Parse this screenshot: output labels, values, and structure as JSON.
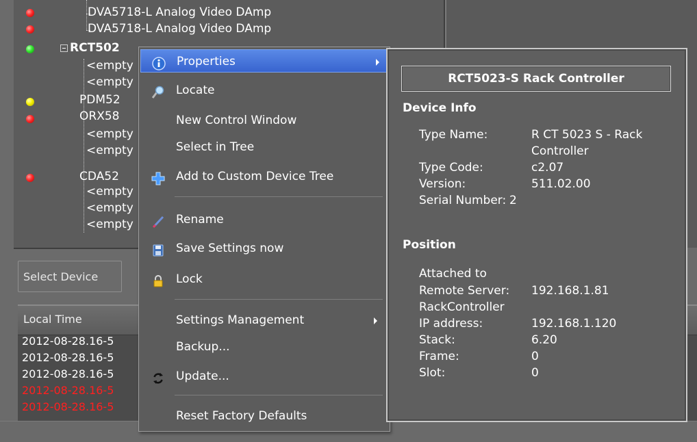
{
  "tree": {
    "items": [
      {
        "label": "DVA5718-L Analog Video DAmp",
        "status": "red"
      },
      {
        "label": "DVA5718-L Analog Video DAmp",
        "status": "red"
      },
      {
        "label": "RCT502",
        "status": "green",
        "expanded": true
      },
      {
        "label": "<empty",
        "status": "none"
      },
      {
        "label": "<empty",
        "status": "none"
      },
      {
        "label": "PDM52",
        "status": "yellow"
      },
      {
        "label": "ORX58",
        "status": "red"
      },
      {
        "label": "<empty",
        "status": "none"
      },
      {
        "label": "<empty",
        "status": "none"
      },
      {
        "label": "CDA52",
        "status": "red"
      },
      {
        "label": "<empty",
        "status": "none"
      },
      {
        "label": "<empty",
        "status": "none"
      },
      {
        "label": "<empty",
        "status": "none"
      }
    ],
    "colors": {
      "red": "#ff2a2a",
      "green": "#35e52f",
      "yellow": "#f5f000"
    }
  },
  "select_device_label": "Select Device",
  "log": {
    "column_header": "Local Time",
    "rows": [
      {
        "text": "2012-08-28.16-5",
        "color": "#ffffff"
      },
      {
        "text": "2012-08-28.16-5",
        "color": "#ffffff"
      },
      {
        "text": "2012-08-28.16-5",
        "color": "#ffffff"
      },
      {
        "text": "2012-08-28.16-5",
        "color": "#ff2020"
      },
      {
        "text": "2012-08-28.16-5",
        "color": "#ff2020"
      }
    ]
  },
  "context_menu": {
    "items": [
      {
        "label": "Properties",
        "icon": "info-icon",
        "submenu": true,
        "highlighted": true
      },
      {
        "label": "Locate",
        "icon": "magnifier-icon"
      },
      {
        "label": "New Control Window",
        "icon": ""
      },
      {
        "label": "Select in Tree",
        "icon": ""
      },
      {
        "label": "Add to Custom Device Tree",
        "icon": "plus-icon"
      },
      {
        "label": "Rename",
        "icon": "pencil-icon"
      },
      {
        "label": "Save Settings now",
        "icon": "floppy-disk-icon"
      },
      {
        "label": "Lock",
        "icon": "padlock-icon"
      },
      {
        "label": "Settings Management",
        "icon": "",
        "submenu": true
      },
      {
        "label": "Backup...",
        "icon": ""
      },
      {
        "label": "Update...",
        "icon": "refresh-icon"
      },
      {
        "label": "Reset Factory Defaults",
        "icon": ""
      }
    ]
  },
  "properties": {
    "title": "RCT5023-S Rack Controller",
    "device_info": {
      "heading": "Device Info",
      "type_name_key": "Type Name:",
      "type_name_line1": "R CT 5023 S - Rack",
      "type_name_line2": "Controller",
      "type_code_key": "Type Code:",
      "type_code": "c2.07",
      "version_key": "Version:",
      "version": "511.02.00",
      "serial_key": "Serial Number:",
      "serial": "2"
    },
    "position": {
      "heading": "Position",
      "attached_to": "Attached to",
      "remote_server_key": "Remote Server:",
      "remote_server": "192.168.1.81",
      "rack_controller": "RackController",
      "ip_key": "IP address:",
      "ip": "192.168.1.120",
      "stack_key": "Stack:",
      "stack": "6.20",
      "frame_key": "Frame:",
      "frame": "0",
      "slot_key": "Slot:",
      "slot": "0"
    }
  },
  "colors": {
    "menu_highlight": "#3f6fd8",
    "background": "#6b6b6b"
  }
}
